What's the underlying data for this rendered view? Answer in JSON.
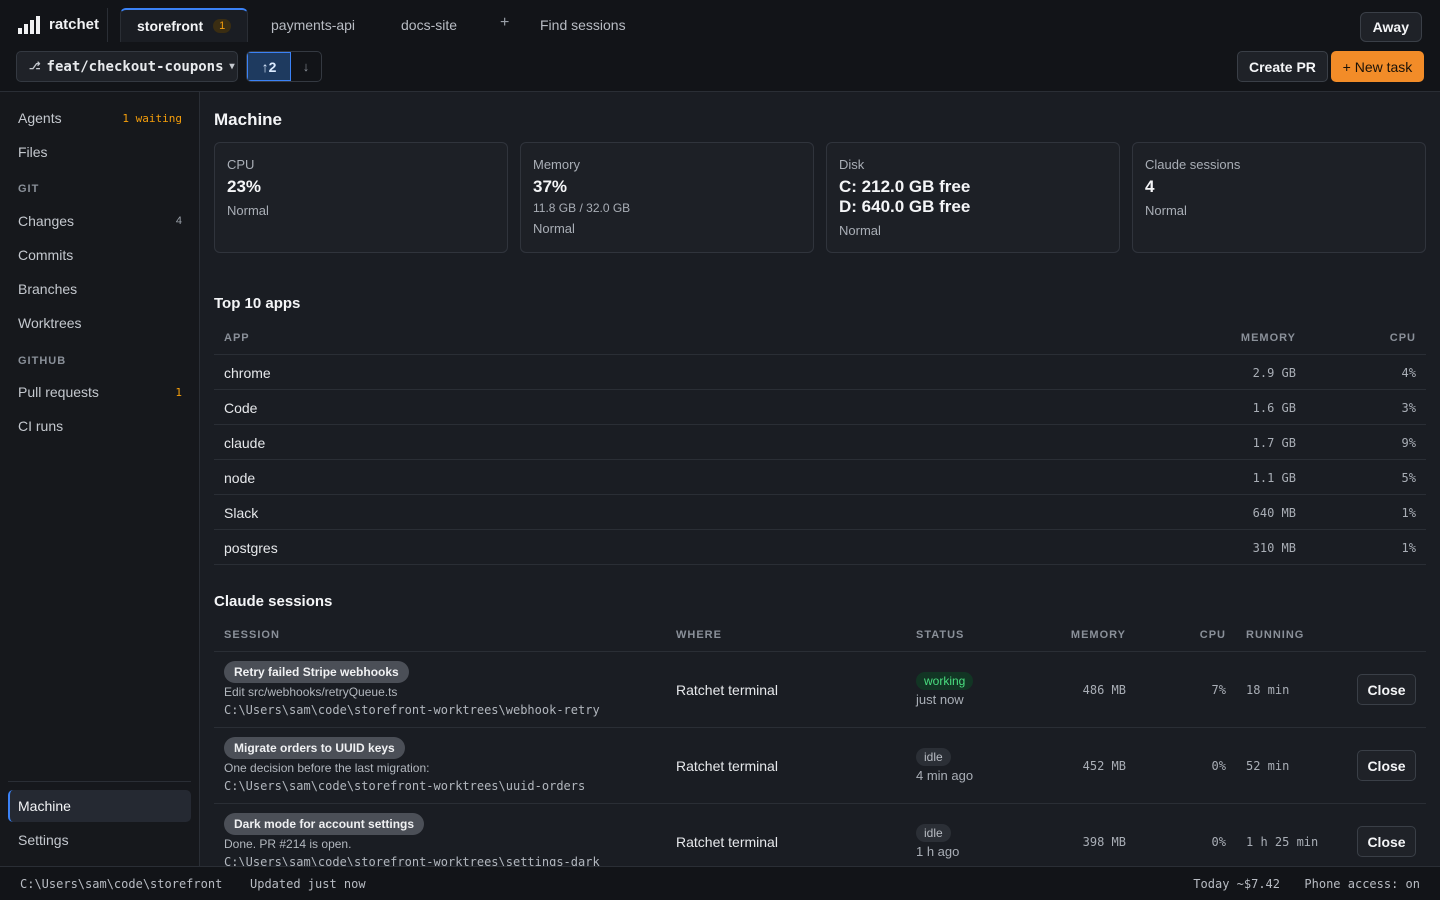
{
  "app": {
    "name": "ratchet",
    "logo_icon": "bar-chart-logo-icon"
  },
  "tabs": [
    {
      "label": "storefront",
      "badge": "1",
      "active": true
    },
    {
      "label": "payments-api"
    },
    {
      "label": "docs-site"
    }
  ],
  "tab_add_label": "+",
  "find_sessions_label": "Find sessions",
  "away_label": "Away",
  "toolbar": {
    "branch_icon": "branch-icon",
    "branch": "feat/checkout-coupons",
    "branch_caret": "▾",
    "push_up": "↑2",
    "pull_down": "↓",
    "create_pr": "Create PR",
    "new_task": "+ New task"
  },
  "sidebar": {
    "agents": {
      "label": "Agents",
      "count": "1 waiting"
    },
    "files": {
      "label": "Files"
    },
    "git_heading": "GIT",
    "changes": {
      "label": "Changes",
      "count": "4"
    },
    "commits": {
      "label": "Commits"
    },
    "branches": {
      "label": "Branches"
    },
    "worktrees": {
      "label": "Worktrees"
    },
    "github_heading": "GITHUB",
    "pull_requests": {
      "label": "Pull requests",
      "count": "1"
    },
    "ci_runs": {
      "label": "CI runs"
    },
    "machine": {
      "label": "Machine"
    },
    "settings": {
      "label": "Settings"
    }
  },
  "machine": {
    "title": "Machine",
    "cards": [
      {
        "label": "CPU",
        "value": "23%",
        "sub": "",
        "status": "Normal"
      },
      {
        "label": "Memory",
        "value": "37%",
        "sub": "11.8 GB / 32.0 GB",
        "status": "Normal"
      },
      {
        "label": "Disk",
        "value": "C: 212.0 GB free",
        "value2": "D: 640.0 GB free",
        "status": "Normal"
      },
      {
        "label": "Claude sessions",
        "value": "4",
        "status": "Normal"
      }
    ]
  },
  "top_apps": {
    "title": "Top 10 apps",
    "columns": {
      "app": "APP",
      "memory": "MEMORY",
      "cpu": "CPU"
    },
    "rows": [
      {
        "app": "chrome",
        "memory": "2.9 GB",
        "cpu": "4%"
      },
      {
        "app": "Code",
        "memory": "1.6 GB",
        "cpu": "3%"
      },
      {
        "app": "claude",
        "memory": "1.7 GB",
        "cpu": "9%"
      },
      {
        "app": "node",
        "memory": "1.1 GB",
        "cpu": "5%"
      },
      {
        "app": "Slack",
        "memory": "640 MB",
        "cpu": "1%"
      },
      {
        "app": "postgres",
        "memory": "310 MB",
        "cpu": "1%"
      }
    ]
  },
  "claude_sessions": {
    "title": "Claude sessions",
    "columns": {
      "session": "SESSION",
      "where": "WHERE",
      "status": "STATUS",
      "memory": "MEMORY",
      "cpu": "CPU",
      "running": "RUNNING"
    },
    "rows": [
      {
        "name": "Retry failed Stripe webhooks",
        "desc": "Edit src/webhooks/retryQueue.ts",
        "path": "C:\\Users\\sam\\code\\storefront-worktrees\\webhook-retry",
        "where": "Ratchet terminal",
        "status": "working",
        "ago": "just now",
        "memory": "486 MB",
        "cpu": "7%",
        "running": "18 min",
        "close": "Close"
      },
      {
        "name": "Migrate orders to UUID keys",
        "desc": "One decision before the last migration:",
        "path": "C:\\Users\\sam\\code\\storefront-worktrees\\uuid-orders",
        "where": "Ratchet terminal",
        "status": "idle",
        "ago": "4 min ago",
        "memory": "452 MB",
        "cpu": "0%",
        "running": "52 min",
        "close": "Close"
      },
      {
        "name": "Dark mode for account settings",
        "desc": "Done. PR #214 is open.",
        "path": "C:\\Users\\sam\\code\\storefront-worktrees\\settings-dark",
        "where": "Ratchet terminal",
        "status": "idle",
        "ago": "1 h ago",
        "memory": "398 MB",
        "cpu": "0%",
        "running": "1 h 25 min",
        "close": "Close"
      }
    ]
  },
  "statusbar": {
    "path": "C:\\Users\\sam\\code\\storefront",
    "updated": "Updated just now",
    "cost": "Today ~$7.42",
    "phone": "Phone access: on"
  }
}
